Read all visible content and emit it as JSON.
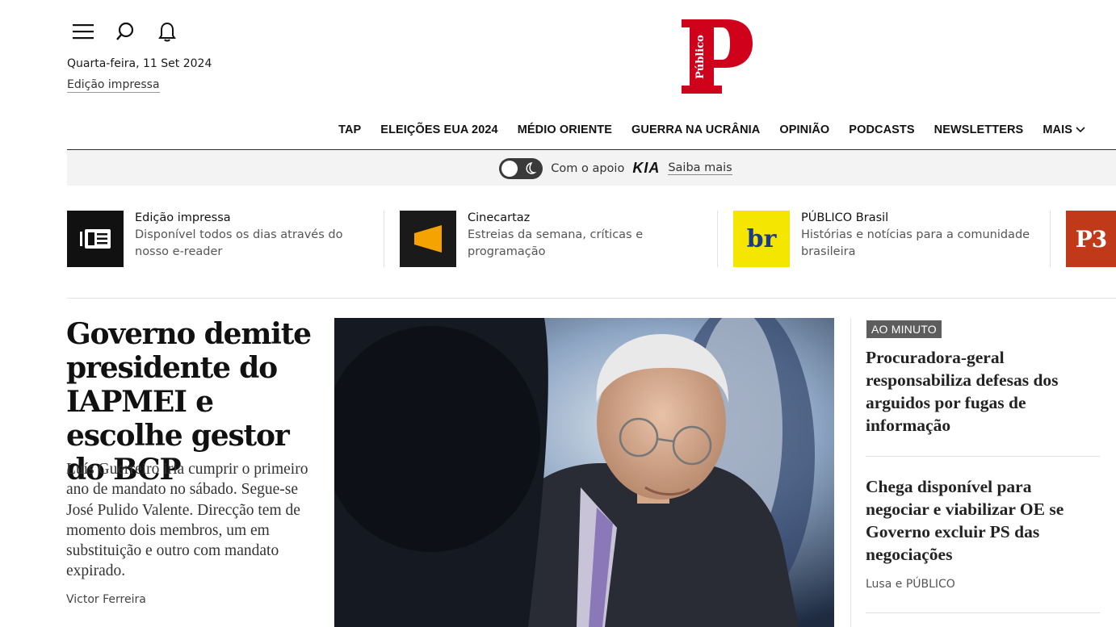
{
  "header": {
    "date": "Quarta-feira, 11 Set 2024",
    "print_edition_link": "Edição impressa",
    "logo_text": "Público"
  },
  "nav": {
    "items": [
      "TAP",
      "ELEIÇÕES EUA 2024",
      "MÉDIO ORIENTE",
      "GUERRA NA UCRÂNIA",
      "OPINIÃO",
      "PODCASTS",
      "NEWSLETTERS",
      "MAIS"
    ]
  },
  "support": {
    "text": "Com o apoio",
    "sponsor": "KIA",
    "link": "Saiba mais"
  },
  "services": [
    {
      "title": "Edição impressa",
      "desc": "Disponível todos os dias através do nosso e-reader",
      "icon": "e-reader-icon",
      "color": "#111111"
    },
    {
      "title": "Cinecartaz",
      "desc": "Estreias da semana, críticas e programação",
      "icon": "cinecartaz-icon",
      "color": "#1a1a1a"
    },
    {
      "title": "PÚBLICO Brasil",
      "desc": "Histórias e notícias para a comunidade brasileira",
      "icon_text": "br",
      "color": "#f5e600"
    },
    {
      "icon_text": "P3",
      "color": "#c03a1a"
    }
  ],
  "lead_story": {
    "headline": "Governo demite presidente do IAPMEI e escolhe gestor do BCP",
    "lead": "Luís Guerreiro iria cumprir o primeiro ano de mandato no sábado. Segue-se José Pulido Valente. Direcção tem de momento dois membros, um em substituição e outro com mandato expirado.",
    "author": "Victor Ferreira"
  },
  "side": {
    "badge": "AO MINUTO",
    "story1": "Procuradora-geral responsabiliza defesas dos arguidos por fugas de informação",
    "story2": "Chega disponível para negociar e viabilizar OE se Governo excluir PS das negociações",
    "story2_meta": "Lusa e PÚBLICO"
  },
  "colors": {
    "brand_red": "#d0021b",
    "nav_text": "#111111"
  }
}
